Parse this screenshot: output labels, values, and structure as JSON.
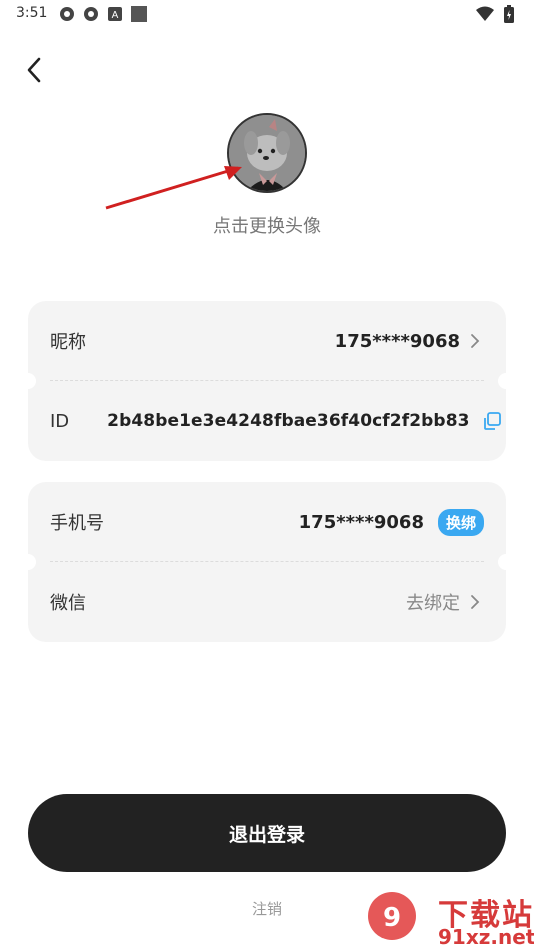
{
  "status_bar": {
    "time": "3:51",
    "left_icons": [
      "app-icon-1",
      "app-icon-2",
      "text-a-icon",
      "square-icon"
    ],
    "right_icons": [
      "wifi-icon",
      "battery-icon"
    ]
  },
  "header": {
    "back_icon": "chevron-left-icon"
  },
  "avatar": {
    "caption": "点击更换头像"
  },
  "profile_card": {
    "nickname_label": "昵称",
    "nickname_value": "175****9068",
    "id_label": "ID",
    "id_value": "2b48be1e3e4248fbae36f40cf2f2bb83"
  },
  "binding_card": {
    "phone_label": "手机号",
    "phone_value": "175****9068",
    "phone_badge": "换绑",
    "wechat_label": "微信",
    "wechat_value": "去绑定"
  },
  "actions": {
    "logout_label": "退出登录",
    "cancel_label": "注销"
  },
  "watermark": {
    "text_top": "下载站",
    "text_bottom": "91xz.net"
  },
  "colors": {
    "accent": "#3aa8f1",
    "button_dark": "#222222",
    "card_bg": "#f4f4f4",
    "arrow": "#d02020"
  }
}
